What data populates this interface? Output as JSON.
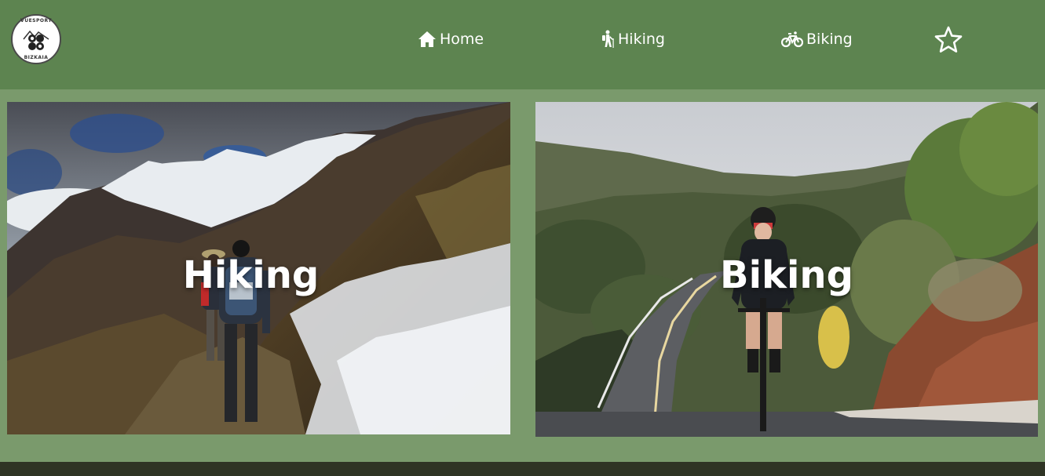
{
  "header": {
    "logo": {
      "text_top": "VUESPORT",
      "text_bottom": "BIZKAIA",
      "icon": "lauburu-logo"
    },
    "nav": [
      {
        "label": "Home",
        "icon": "home-icon"
      },
      {
        "label": "Hiking",
        "icon": "hiker-icon"
      },
      {
        "label": "Biking",
        "icon": "bicycle-icon"
      }
    ],
    "favorites_icon": "star-icon"
  },
  "cards": [
    {
      "title": "Hiking",
      "image": "hikers-on-snowy-mountain-trail"
    },
    {
      "title": "Biking",
      "image": "cyclist-on-mountain-road"
    }
  ],
  "colors": {
    "header_bg": "#5d8450",
    "page_bg": "#7a9a6c",
    "footer_bg": "#2f3424",
    "text": "#ffffff"
  }
}
